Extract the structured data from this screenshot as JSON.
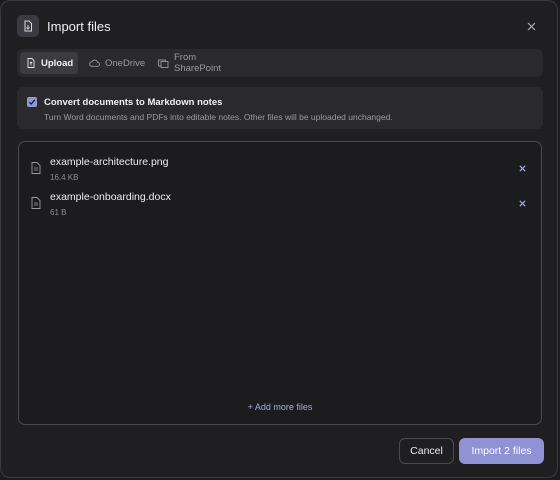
{
  "dialog": {
    "title": "Import files",
    "icon": "file-import-icon"
  },
  "tabs": [
    {
      "label": "Upload",
      "icon": "file-upload-icon",
      "active": true
    },
    {
      "label": "OneDrive",
      "icon": "cloud-icon",
      "active": false
    },
    {
      "label": "From SharePoint",
      "icon": "sharepoint-icon",
      "active": false
    }
  ],
  "convert_option": {
    "checked": true,
    "label": "Convert documents to Markdown notes",
    "description": "Turn Word documents and PDFs into editable notes. Other files will be uploaded unchanged."
  },
  "files": [
    {
      "name": "example-architecture.png",
      "size": "16.4 KB"
    },
    {
      "name": "example-onboarding.docx",
      "size": "61 B"
    }
  ],
  "add_more_label": "+ Add more files",
  "footer": {
    "cancel_label": "Cancel",
    "import_label": "Import 2 files"
  },
  "colors": {
    "accent": "#8f92d3",
    "background": "#1f1f21",
    "panel": "#2a2a2d"
  }
}
